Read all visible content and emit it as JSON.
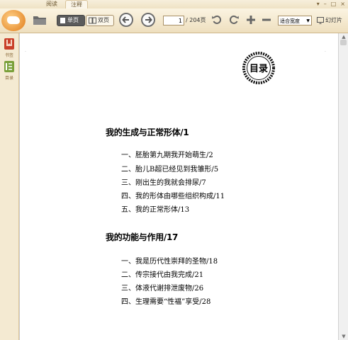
{
  "tabs": [
    "阅读",
    "注释"
  ],
  "toolbar": {
    "single_page": "单页",
    "double_page": "双页",
    "page_current": "1",
    "page_total": "/ 204页",
    "zoom_value": "适合宽度",
    "slideshow": "幻灯片"
  },
  "sidebar": {
    "items": [
      {
        "label": "书签",
        "icon": "bookmark-icon"
      },
      {
        "label": "目录",
        "icon": "toc-icon"
      }
    ]
  },
  "document": {
    "badge": "目录",
    "sections": [
      {
        "heading": "我的生成与正常形体/1",
        "items": [
          "一、胚胎第九期我开始萌生/2",
          "二、胎儿B超已经见到我雏形/5",
          "三、刚出生的我就会排尿/7",
          "四、我的形体由哪些组织构成/11",
          "五、我的正常形体/13"
        ]
      },
      {
        "heading": "我的功能与作用/17",
        "items": [
          "一、我是历代性崇拜的圣物/18",
          "二、传宗接代由我完成/21",
          "三、体液代谢排泄废物/26",
          "四、生理需要“性福”享受/28"
        ]
      }
    ]
  },
  "colors": {
    "toolbar_bg": "#f3e7cc",
    "sidebar_bg": "#f4ead2",
    "accent": "#e07b18",
    "page_bg": "#ffffff"
  }
}
